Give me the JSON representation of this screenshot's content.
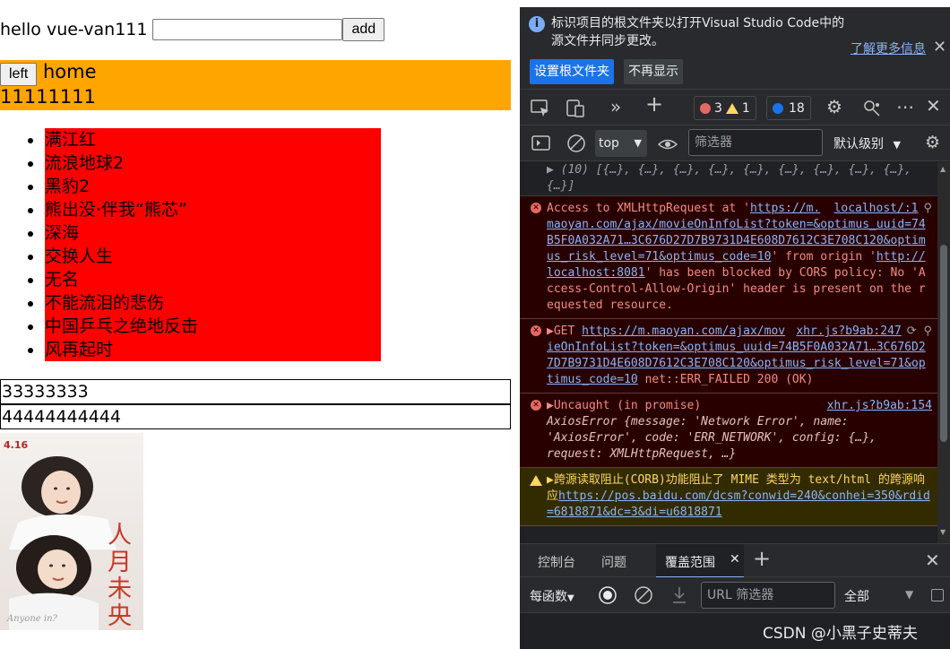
{
  "page": {
    "greeting": "hello vue-van111",
    "input_value": "",
    "add_label": "add",
    "left_label": "left",
    "home_label": "home",
    "ones_text": "11111111",
    "movies": [
      "满江红",
      "流浪地球2",
      "黑豹2",
      "熊出没·伴我“熊芯”",
      "深海",
      "交换人生",
      "无名",
      "不能流泪的悲伤",
      "中国乒乓之绝地反击",
      "风再起时"
    ],
    "box3_text": "33333333",
    "box4_text": "44444444444",
    "poster": {
      "date_line1": "4.16",
      "date_line2": "",
      "title": "人月未央"
    },
    "colors": {
      "orange": "#ffa500",
      "red": "#ff0000"
    }
  },
  "devtools": {
    "info": {
      "text": "标识项目的根文件夹以打开Visual Studio Code中的源文件并同步更改。",
      "learn_more": "了解更多信息",
      "set_root_btn": "设置根文件夹",
      "dont_show_btn": "不再显示"
    },
    "toolbar": {
      "errors": "3",
      "warnings": "1",
      "issues": "18"
    },
    "console_toolbar": {
      "context": "top",
      "filter_placeholder": "筛选器",
      "levels": "默认级别"
    },
    "messages": {
      "array_line": "▶ (10) [{…}, {…}, {…}, {…}, {…}, {…}, {…}, {…}, {…}, {…}]",
      "cors": {
        "prefix": "Access to XMLHttpRequest at '",
        "url": "https://m.maoyan.com/ajax/movieOnInfoList?token=&optimus_uuid=74B5F0A032A71…3C676D27D7B9731D4E608D7612C3E708C120&optimus_risk_level=71&optimus_code=10",
        "mid": "' from origin '",
        "origin": "http://localhost:8081",
        "suffix": "' has been blocked by CORS policy: No 'Access-Control-Allow-Origin' header is present on the requested resource.",
        "source": "localhost/:1"
      },
      "get": {
        "prefix": "▶GET ",
        "url": "https://m.maoyan.com/ajax/movieOnInfoList?token=&optimus_uuid=74B5F0A032A71…3C676D27D7B9731D4E608D7612C3E708C120&optimus_risk_level=71&optimus_code=10",
        "suffix": " net::ERR_FAILED 200 (OK)",
        "source": "xhr.js?b9ab:247"
      },
      "uncaught": {
        "title": "▶Uncaught (in promise)",
        "detail": "AxiosError {message: 'Network Error', name: 'AxiosError', code: 'ERR_NETWORK', config: {…}, request: XMLHttpRequest, …}",
        "source": "xhr.js?b9ab:154"
      },
      "corb": {
        "text": "▶跨源读取阻止(CORB)功能阻止了 MIME 类型为 text/html 的跨源响应",
        "url": "https://pos.baidu.com/dcsm?conwid=240&conhei=350&rdid=6818871&dc=3&di=u6818871"
      }
    },
    "drawer": {
      "tab_console": "控制台",
      "tab_issues": "问题",
      "tab_coverage": "覆盖范围"
    },
    "coverage": {
      "per_function": "每函数",
      "url_placeholder": "URL 筛选器",
      "all": "全部"
    },
    "watermark": "CSDN @小黑子史蒂夫"
  }
}
